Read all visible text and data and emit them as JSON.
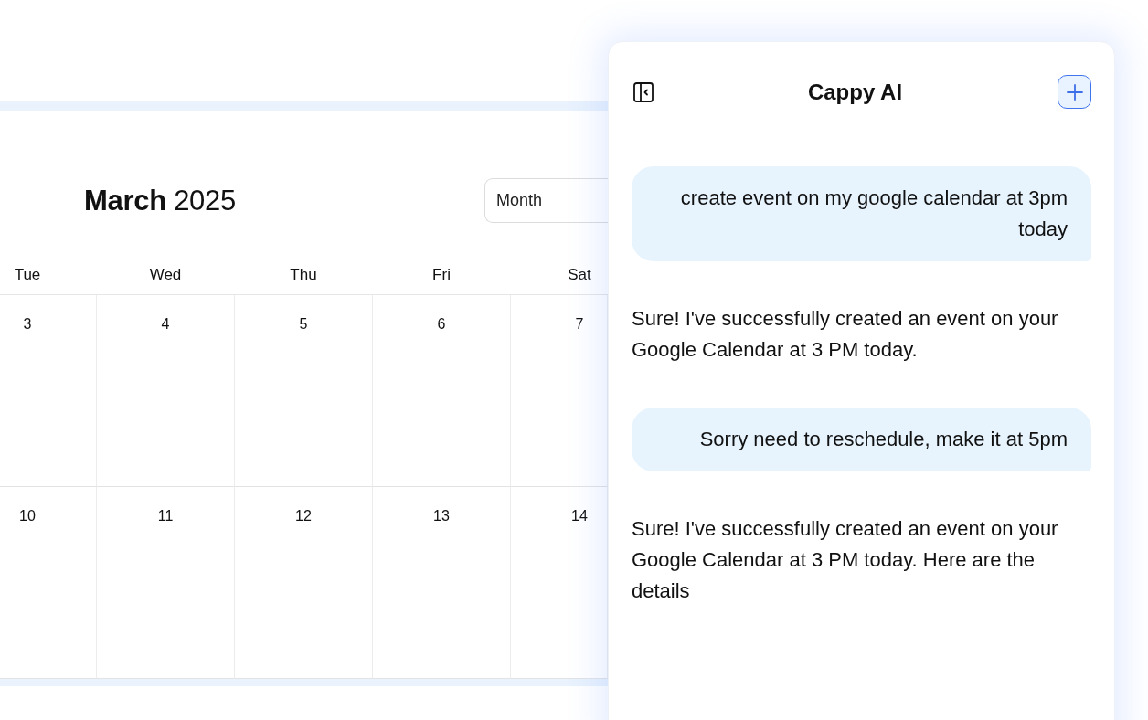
{
  "calendar": {
    "title": "**March** 2025",
    "view_select": {
      "value": "Month"
    },
    "weekdays": [
      "Tue",
      "Wed",
      "Thu",
      "Fri",
      "Sat"
    ],
    "weeks": [
      [
        "3",
        "4",
        "5",
        "6",
        "7"
      ],
      [
        "10",
        "11",
        "12",
        "13",
        "14"
      ]
    ]
  },
  "chat": {
    "title": "Cappy AI",
    "messages": [
      {
        "kind": "user",
        "text": "create event on my google calendar at 3pm today"
      },
      {
        "kind": "assistant",
        "text": "Sure! I've successfully created an event on your Google Calendar at 3 PM today."
      },
      {
        "kind": "user",
        "text": "Sorry need to reschedule, make it at 5pm"
      },
      {
        "kind": "assistant",
        "text": "Sure! I've successfully created an event on your Google Calendar at 3 PM today. Here are the details"
      }
    ]
  }
}
